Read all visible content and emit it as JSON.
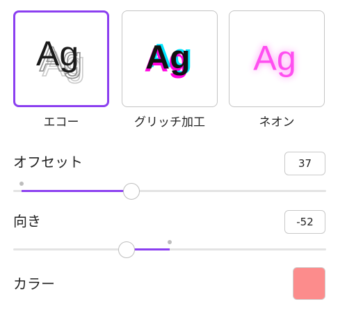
{
  "effects": [
    {
      "label": "エコー",
      "preview_text": "Ag",
      "selected": true
    },
    {
      "label": "グリッチ加工",
      "preview_text": "Ag",
      "selected": false
    },
    {
      "label": "ネオン",
      "preview_text": "Ag",
      "selected": false
    }
  ],
  "offset": {
    "label": "オフセット",
    "value": "37",
    "min": 0,
    "max": 100,
    "level": 37
  },
  "direction": {
    "label": "向き",
    "value": "-52",
    "min": -180,
    "max": 180,
    "level": -52
  },
  "color": {
    "label": "カラー",
    "swatch": "#fc8c8c"
  },
  "colors": {
    "accent": "#8b3ff0",
    "glitch_magenta": "#ff00e0",
    "glitch_cyan": "#00e5ff",
    "neon": "#ff33ee"
  }
}
